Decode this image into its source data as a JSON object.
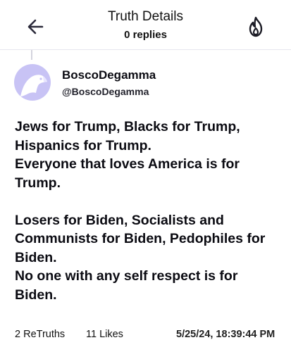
{
  "header": {
    "title": "Truth Details",
    "subtitle": "0 replies"
  },
  "icons": {
    "back": "arrow-left-icon",
    "trending": "flame-icon"
  },
  "colors": {
    "avatar_bg": "#c8c3f5",
    "text": "#0b0b12",
    "divider": "#e6e6ee"
  },
  "author": {
    "name": "BoscoDegamma",
    "handle": "@BoscoDegamma"
  },
  "post": {
    "lines": [
      "Jews for Trump, Blacks for Trump, Hispanics for Trump.",
      "Everyone that loves America is for Trump.",
      "",
      "Losers for Biden, Socialists and Communists for Biden, Pedophiles for Biden.",
      "No one with any self respect is for Biden."
    ]
  },
  "stats": {
    "retruths": "2 ReTruths",
    "likes": "11 Likes",
    "timestamp": "5/25/24, 18:39:44 PM"
  }
}
